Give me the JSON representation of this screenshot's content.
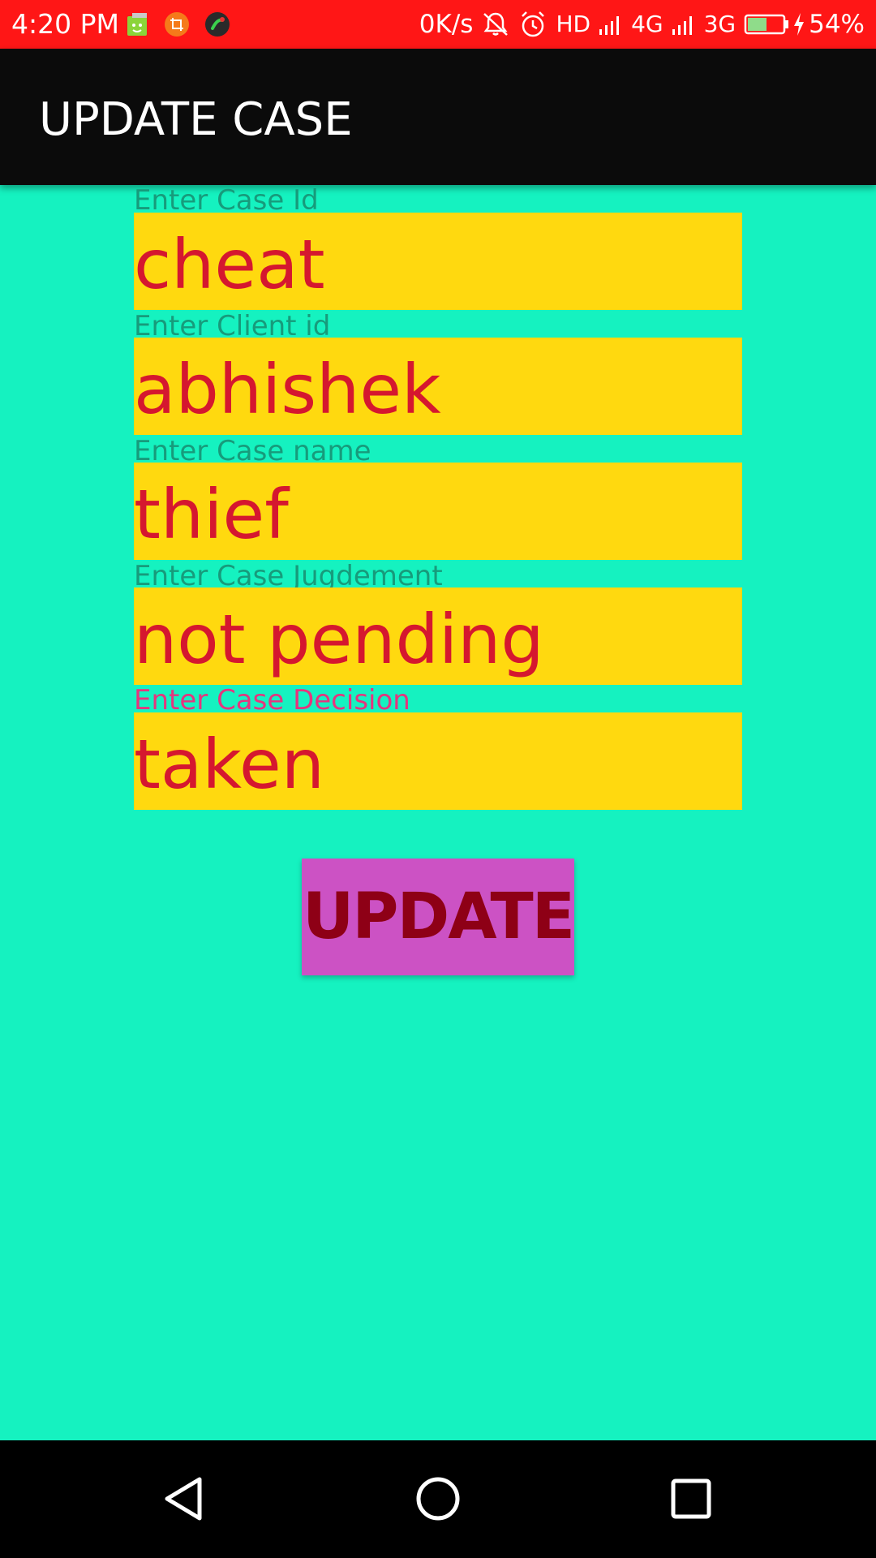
{
  "status_bar": {
    "time": "4:20 PM",
    "network_speed": "0K/s",
    "hd_label": "HD",
    "network_4g": "4G",
    "network_3g": "3G",
    "battery_percent": "54%",
    "battery_level": 0.54,
    "icons": [
      "notification-app-icon",
      "crop-app-icon",
      "call-recorder-icon",
      "mute-icon",
      "alarm-icon",
      "signal-icon",
      "battery-icon",
      "charging-icon"
    ]
  },
  "app_bar": {
    "title": "UPDATE CASE"
  },
  "form": {
    "fields": [
      {
        "label": "Enter Case Id",
        "value": "cheat"
      },
      {
        "label": "Enter Client id",
        "value": "abhishek"
      },
      {
        "label": "Enter Case name",
        "value": "thief"
      },
      {
        "label": "Enter Case Jugdement",
        "value": "not pending"
      },
      {
        "label": "Enter Case Decision",
        "value": "taken"
      }
    ],
    "submit_label": "UPDATE"
  },
  "nav_bar": {
    "icons": [
      "back-icon",
      "home-icon",
      "recents-icon"
    ]
  },
  "colors": {
    "status_bar": "#ff1616",
    "app_bar": "#0b0b0b",
    "background": "#15f2c0",
    "field_background": "#ffd90f",
    "field_text": "#d5172f",
    "label_text": "#179b7b",
    "active_label_text": "#e5357e",
    "button_background": "#cc52c4",
    "button_text": "#8e0016"
  }
}
